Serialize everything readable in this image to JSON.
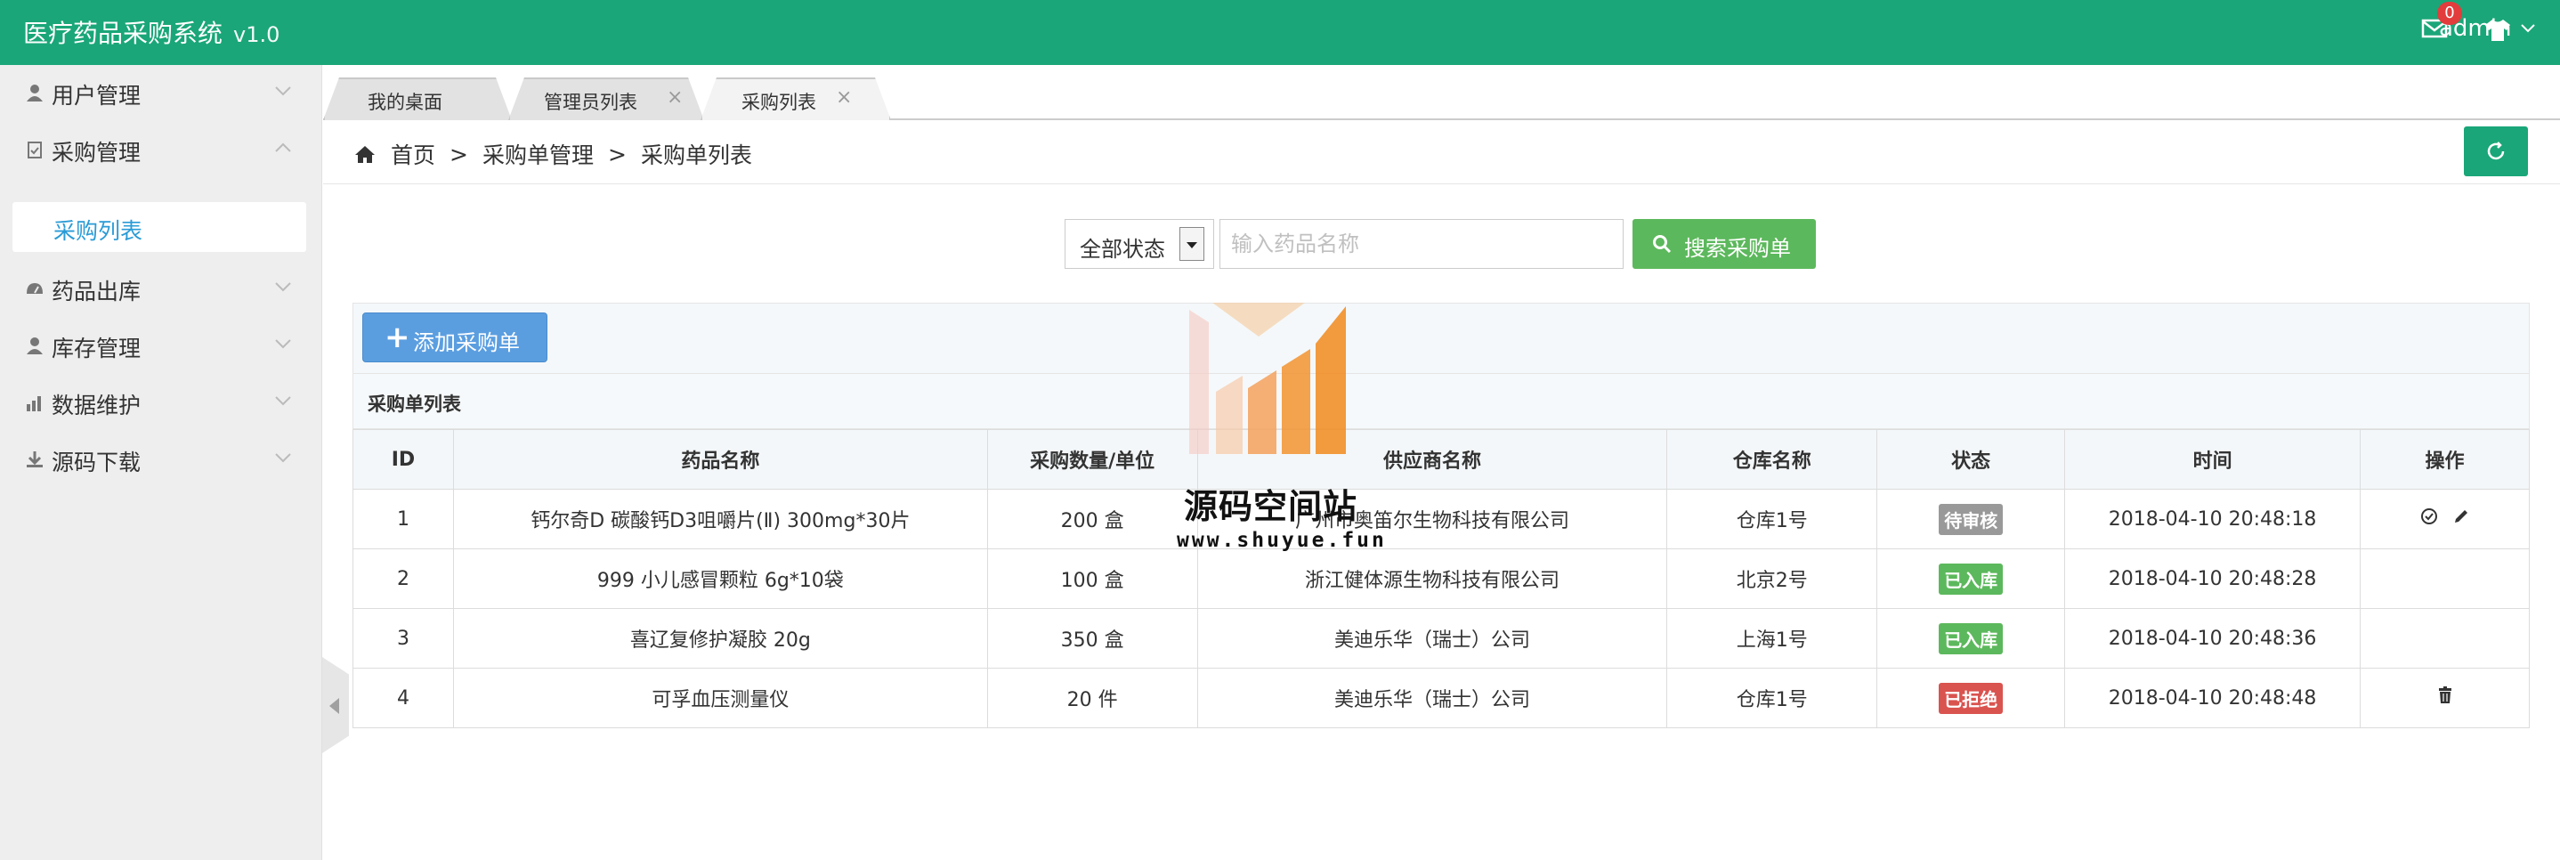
{
  "header": {
    "app_title": "医疗药品采购系统",
    "version": "v1.0",
    "user_name": "admin",
    "mail_badge": "0",
    "bg_color": "#1aa678"
  },
  "sidebar": {
    "items": [
      {
        "label": "用户管理",
        "icon": "user-icon",
        "expanded": false
      },
      {
        "label": "采购管理",
        "icon": "clipboard-icon",
        "expanded": true
      },
      {
        "label": "药品出库",
        "icon": "dashboard-icon",
        "expanded": false
      },
      {
        "label": "库存管理",
        "icon": "user-icon",
        "expanded": false
      },
      {
        "label": "数据维护",
        "icon": "bar-chart-icon",
        "expanded": false
      },
      {
        "label": "源码下载",
        "icon": "download-icon",
        "expanded": false
      }
    ],
    "active_subitem": "采购列表"
  },
  "tabs": [
    {
      "label": "我的桌面",
      "closable": false
    },
    {
      "label": "管理员列表",
      "closable": true
    },
    {
      "label": "采购列表",
      "closable": true,
      "active": true
    }
  ],
  "breadcrumb": [
    "首页",
    "采购单管理",
    "采购单列表"
  ],
  "breadcrumb_sep": ">",
  "search": {
    "status_selected": "全部状态",
    "placeholder": "输入药品名称",
    "button_label": "搜索采购单"
  },
  "toolbar": {
    "add_label": "添加采购单"
  },
  "list_title": "采购单列表",
  "table": {
    "columns": [
      "ID",
      "药品名称",
      "采购数量/单位",
      "供应商名称",
      "仓库名称",
      "状态",
      "时间",
      "操作"
    ],
    "rows": [
      {
        "id": "1",
        "name": "钙尔奇D 碳酸钙D3咀嚼片(Ⅱ) 300mg*30片",
        "qty": "200 盒",
        "supplier": "广州市奥笛尔生物科技有限公司",
        "warehouse": "仓库1号",
        "status": "待审核",
        "status_color": "#999999",
        "time": "2018-04-10 20:48:18",
        "ops": [
          "check-icon",
          "edit-icon"
        ]
      },
      {
        "id": "2",
        "name": "999 小儿感冒颗粒 6g*10袋",
        "qty": "100 盒",
        "supplier": "浙江健体源生物科技有限公司",
        "warehouse": "北京2号",
        "status": "已入库",
        "status_color": "#5cb85c",
        "time": "2018-04-10 20:48:28",
        "ops": []
      },
      {
        "id": "3",
        "name": "喜辽复修护凝胶 20g",
        "qty": "350 盒",
        "supplier": "美迪乐华（瑞士）公司",
        "warehouse": "上海1号",
        "status": "已入库",
        "status_color": "#5cb85c",
        "time": "2018-04-10 20:48:36",
        "ops": []
      },
      {
        "id": "4",
        "name": "可孚血压测量仪",
        "qty": "20 件",
        "supplier": "美迪乐华（瑞士）公司",
        "warehouse": "仓库1号",
        "status": "已拒绝",
        "status_color": "#d9534f",
        "time": "2018-04-10 20:48:48",
        "ops": [
          "trash-icon"
        ]
      }
    ]
  },
  "watermark": {
    "title": "源码空间站",
    "url": "www.shuyue.fun"
  }
}
